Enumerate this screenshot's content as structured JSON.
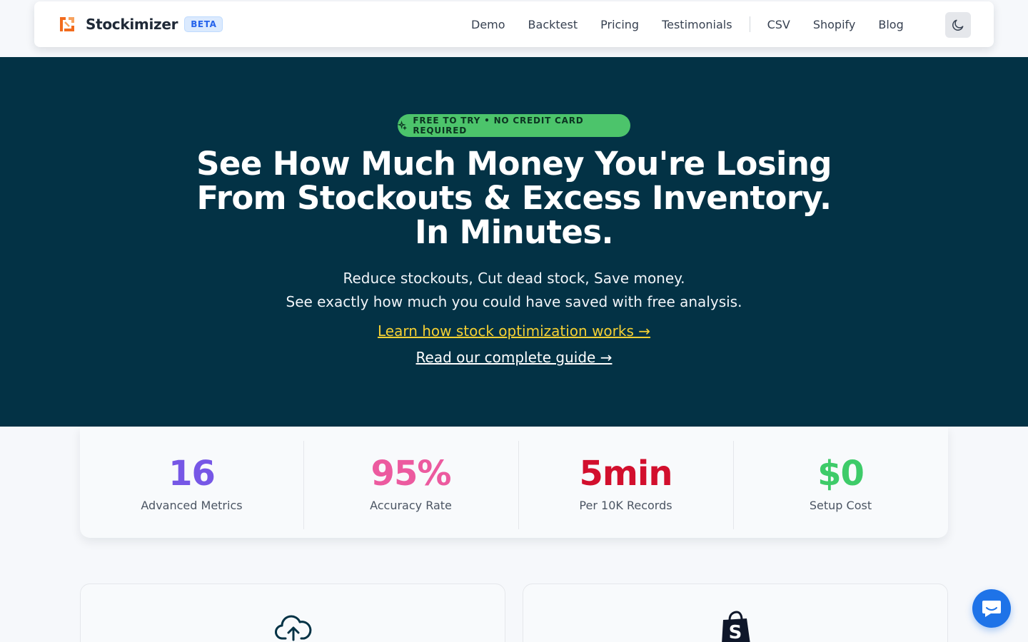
{
  "brand": {
    "name": "Stockimizer",
    "badge": "BETA",
    "logo_icon": "stockimizer-logo-icon",
    "accent_color": "#f26b1d"
  },
  "nav": {
    "links": [
      "Demo",
      "Backtest",
      "Pricing",
      "Testimonials",
      "CSV",
      "Shopify",
      "Blog"
    ],
    "theme_toggle_icon": "moon-icon"
  },
  "hero": {
    "background_color": "#033245",
    "pill": {
      "text": "FREE TO TRY • NO CREDIT CARD REQUIRED",
      "icon": "sparkles-icon",
      "color": "#4cc46b"
    },
    "title_lines": [
      "See How Much Money You're Losing",
      "From Stockouts & Excess Inventory.",
      "In Minutes."
    ],
    "subtitle_lines": [
      "Reduce stockouts, Cut dead stock, Save money.",
      "See exactly how much you could have saved with free analysis."
    ],
    "link_primary": "Learn how stock optimization works →",
    "link_primary_color": "#f5d033",
    "link_secondary": "Read our complete guide →"
  },
  "stats": [
    {
      "value": "16",
      "label": "Advanced Metrics",
      "color": "#7657e6"
    },
    {
      "value": "95%",
      "label": "Accuracy Rate",
      "color": "#ec5a9f"
    },
    {
      "value": "5min",
      "label": "Per 10K Records",
      "color": "#d20f2d"
    },
    {
      "value": "$0",
      "label": "Setup Cost",
      "color": "#3ecb69"
    }
  ],
  "cards": [
    {
      "icon": "cloud-upload-icon"
    },
    {
      "icon": "shopify-bag-icon"
    }
  ],
  "chat": {
    "icon": "chat-bubble-icon",
    "color": "#1e73e8"
  }
}
